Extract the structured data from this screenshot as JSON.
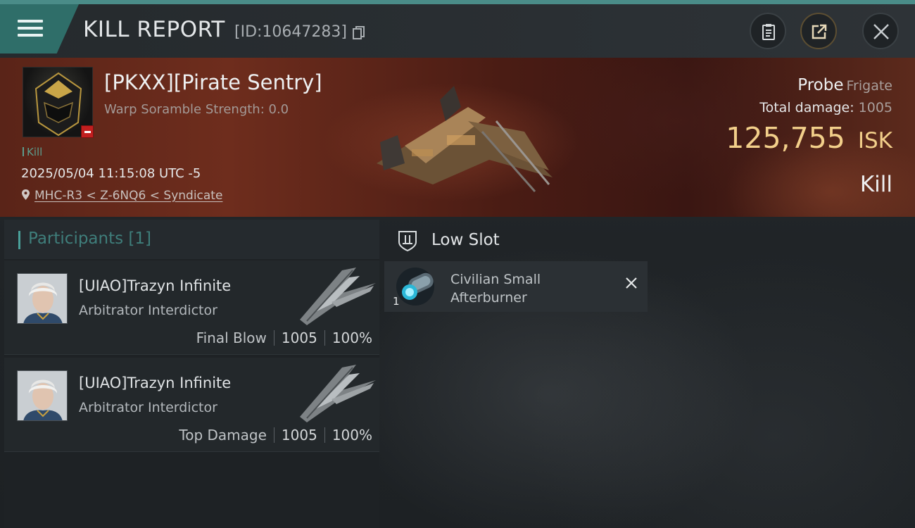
{
  "header": {
    "title": "KILL REPORT",
    "report_id": "[ID:10647283]",
    "buttons": [
      "clipboard-icon",
      "share-icon",
      "close-icon"
    ]
  },
  "victim": {
    "name": "[PKXX][Pirate Sentry]",
    "warp_scramble": "Warp Soramble Strength: 0.0",
    "kill_tag": "Kill",
    "timestamp": "2025/05/04 11:15:08 UTC -5",
    "location": "MHC-R3 < Z-6NQ6 < Syndicate",
    "ship_name": "Probe",
    "ship_class": "Frigate",
    "total_damage_label": "Total damage:",
    "total_damage": "1005",
    "isk_value": "125,755",
    "isk_unit": "ISK",
    "kill_type": "Kill"
  },
  "participants": {
    "header": "Participants [1]",
    "rows": [
      {
        "name": "[UIAO]Trazyn Infinite",
        "ship": "Arbitrator Interdictor",
        "role": "Final Blow",
        "damage": "1005",
        "percent": "100%"
      },
      {
        "name": "[UIAO]Trazyn Infinite",
        "ship": "Arbitrator Interdictor",
        "role": "Top Damage",
        "damage": "1005",
        "percent": "100%"
      }
    ]
  },
  "low_slot": {
    "title": "Low Slot",
    "modules": [
      {
        "name": "Civilian Small Afterburner",
        "quantity": "1"
      }
    ]
  },
  "colors": {
    "accent_teal": "#2f6e69",
    "isk_gold": "#f2cf8a",
    "banner_red": "#5a2418",
    "badge_red": "#c21f1f"
  }
}
